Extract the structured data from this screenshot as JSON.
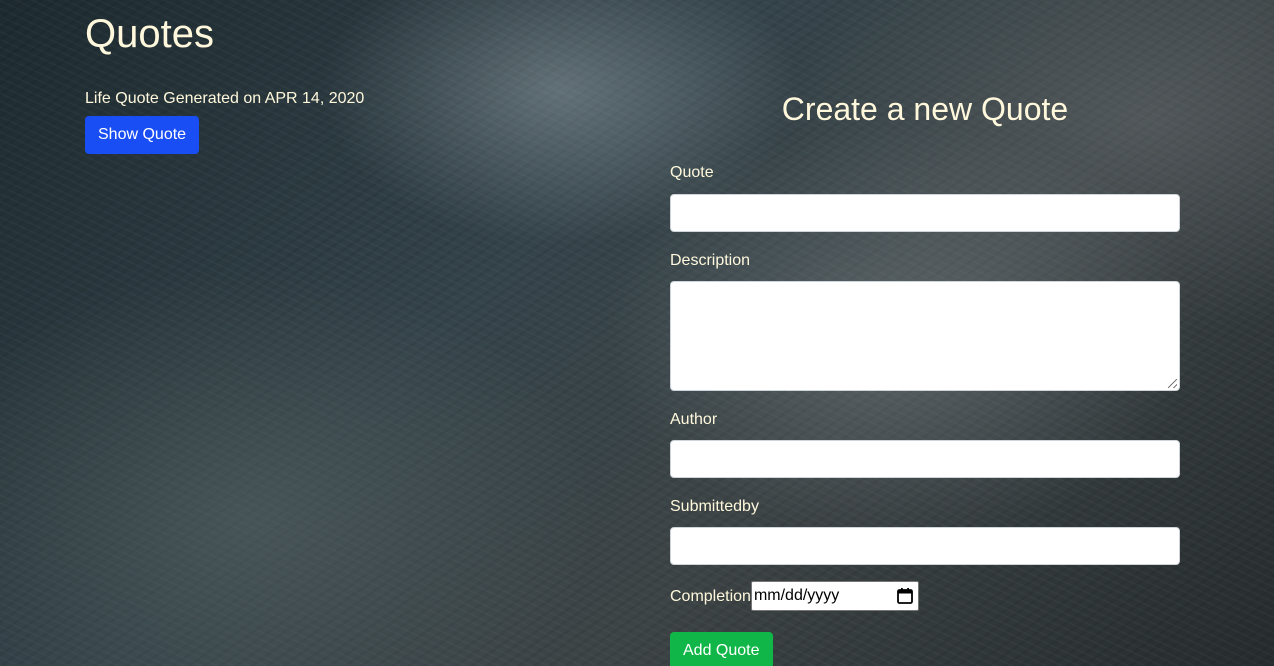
{
  "header": {
    "title": "Quotes"
  },
  "quote_list": {
    "items": [
      {
        "text": "Life Quote Generated on APR 14, 2020",
        "show_button_label": "Show Quote"
      }
    ]
  },
  "form": {
    "title": "Create a new Quote",
    "fields": {
      "quote": {
        "label": "Quote",
        "value": ""
      },
      "description": {
        "label": "Description",
        "value": ""
      },
      "author": {
        "label": "Author",
        "value": ""
      },
      "submittedby": {
        "label": "Submittedby",
        "value": ""
      },
      "completion": {
        "label": "Completion",
        "placeholder": "mm/dd/yyyy"
      }
    },
    "submit_label": "Add Quote"
  },
  "colors": {
    "text": "#fff8dc",
    "primary_button": "#1a4ef5",
    "success_button": "#10b647"
  },
  "icons": {
    "date_picker": "calendar-icon"
  }
}
